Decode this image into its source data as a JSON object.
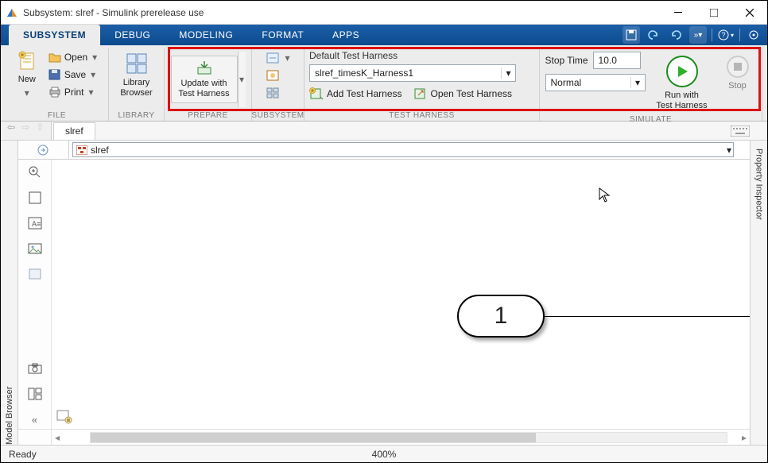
{
  "window": {
    "title": "Subsystem: slref - Simulink prerelease use"
  },
  "tabs": {
    "subsystem": "SUBSYSTEM",
    "debug": "DEBUG",
    "modeling": "MODELING",
    "format": "FORMAT",
    "apps": "APPS"
  },
  "ribbon": {
    "file": {
      "new": "New",
      "open": "Open",
      "save": "Save",
      "print": "Print",
      "group": "FILE"
    },
    "library": {
      "browser": "Library\nBrowser",
      "group": "LIBRARY"
    },
    "prepare": {
      "update": "Update with\nTest Harness",
      "group": "PREPARE"
    },
    "subsystem_group": "SUBSYSTEM",
    "harness": {
      "heading": "Default Test Harness",
      "selected": "slref_timesK_Harness1",
      "add": "Add Test Harness",
      "open": "Open Test Harness",
      "group": "TEST HARNESS"
    },
    "simulate": {
      "stoptime_label": "Stop Time",
      "stoptime_value": "10.0",
      "mode": "Normal",
      "run": "Run with\nTest Harness",
      "stop": "Stop",
      "group": "SIMULATE"
    }
  },
  "breadcrumb": {
    "tab": "slref"
  },
  "path": {
    "text": "slref"
  },
  "sidebars": {
    "left": "Model Browser",
    "right": "Property Inspector"
  },
  "canvas": {
    "block_label": "1"
  },
  "status": {
    "ready": "Ready",
    "zoom": "400%"
  }
}
